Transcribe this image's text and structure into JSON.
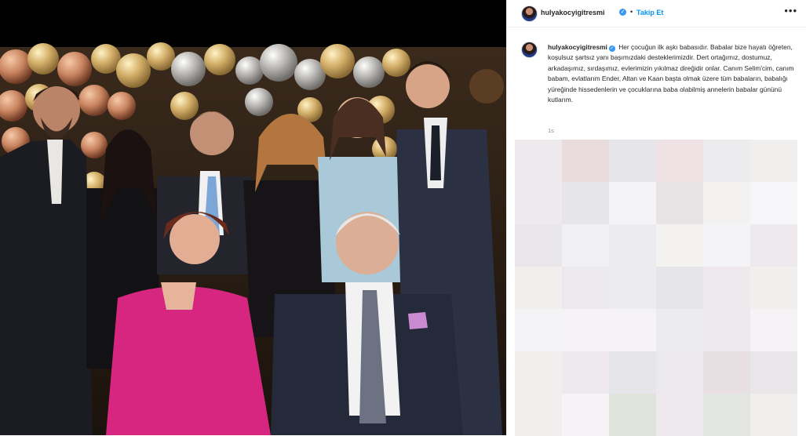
{
  "post": {
    "username": "hulyakocyigitresmi",
    "verified_mark": "✓",
    "separator": "•",
    "follow_label": "Takip Et",
    "more_label": "•••",
    "caption_text": "Her çocuğun ilk aşkı babasıdır. Babalar bize hayatı öğreten, koşulsuz şartsız yanı başımızdaki desteklerimizdir. Dert ortağımız, dostumuz, arkadaşımız, sırdaşımız, evlerimizin yıkılmaz direğidir onlar. Canım Selim'cim, canım babam, evlatlarım Ender, Altan ve Kaan başta olmak üzere tüm babaların, babalığı yüreğinde hissedenlerin ve çocuklarına baba olabilmiş annelerin babalar gününü kutlarım.",
    "timestamp": "1s"
  },
  "colors": {
    "accent": "#0095f6",
    "verified": "#3897f0",
    "muted": "#8e8e8e"
  },
  "icons": {
    "verified": "verified-badge-icon",
    "more": "more-options-icon"
  }
}
